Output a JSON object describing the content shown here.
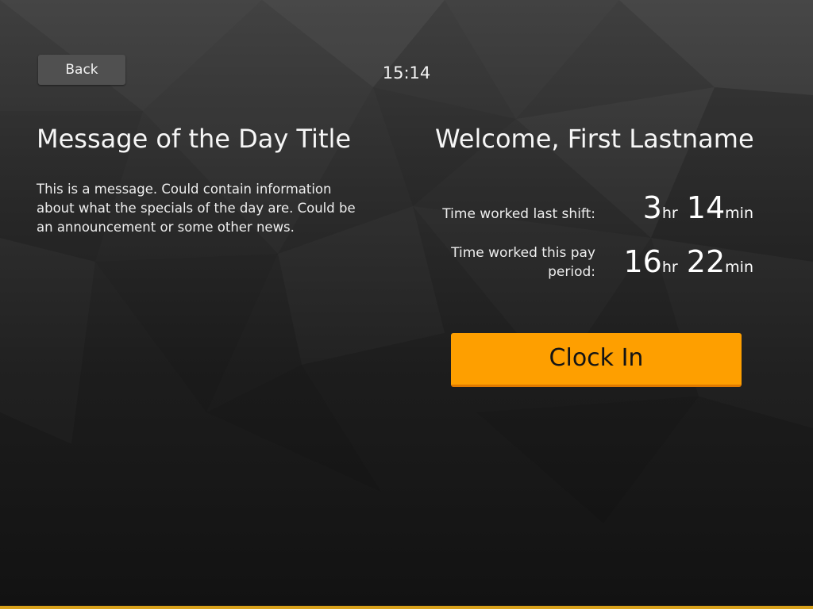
{
  "header": {
    "back_label": "Back",
    "time": "15:14"
  },
  "message": {
    "title": "Message of the Day Title",
    "body": "This is a message. Could contain information about what the specials of the day are. Could be an announcement or some other news."
  },
  "welcome": {
    "text": "Welcome, First Lastname",
    "stats": [
      {
        "label": "Time worked last shift:",
        "hours": "3",
        "hours_unit": "hr",
        "minutes": "14",
        "minutes_unit": "min"
      },
      {
        "label": "Time worked this pay period:",
        "hours": "16",
        "hours_unit": "hr",
        "minutes": "22",
        "minutes_unit": "min"
      }
    ]
  },
  "actions": {
    "clock_in_label": "Clock In"
  },
  "colors": {
    "accent": "#fe9f00",
    "bottom_bar": "#d9a21b"
  }
}
